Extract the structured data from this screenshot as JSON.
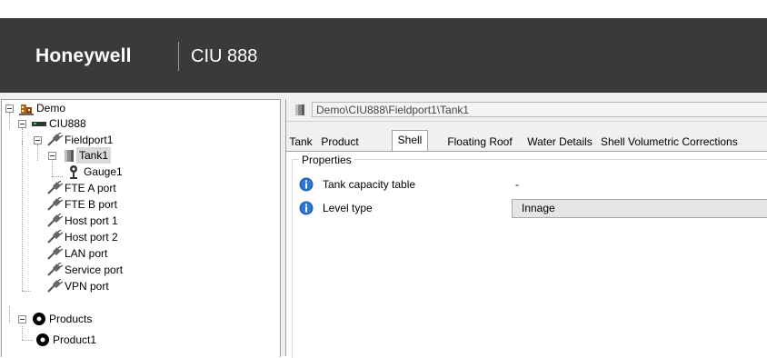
{
  "header": {
    "brand": "Honeywell",
    "product": "CIU 888",
    "background": "#3a3a3a"
  },
  "tree": {
    "nodes": [
      {
        "label": "Demo",
        "icon": "building-icon"
      },
      {
        "label": "CIU888",
        "icon": "device-icon"
      },
      {
        "label": "Fieldport1",
        "icon": "port-plug-icon"
      },
      {
        "label": "Tank1",
        "icon": "tank-icon",
        "selected": true
      },
      {
        "label": "Gauge1",
        "icon": "gauge-icon"
      },
      {
        "label": "FTE A port",
        "icon": "port-plug-icon"
      },
      {
        "label": "FTE B port",
        "icon": "port-plug-icon"
      },
      {
        "label": "Host port 1",
        "icon": "port-plug-icon"
      },
      {
        "label": "Host port 2",
        "icon": "port-plug-icon"
      },
      {
        "label": "LAN port",
        "icon": "port-plug-icon"
      },
      {
        "label": "Service port",
        "icon": "port-plug-icon"
      },
      {
        "label": "VPN port",
        "icon": "port-plug-icon"
      },
      {
        "label": "Products",
        "icon": "product-icon"
      },
      {
        "label": "Product1",
        "icon": "product-icon"
      }
    ]
  },
  "path": "Demo\\CIU888\\Fieldport1\\Tank1",
  "tabs": [
    {
      "label": "Tank",
      "active": false
    },
    {
      "label": "Product",
      "active": false
    },
    {
      "label": "Shell",
      "active": true
    },
    {
      "label": "Floating Roof",
      "active": false
    },
    {
      "label": "Water Details",
      "active": false
    },
    {
      "label": "Shell Volumetric Corrections",
      "active": false
    }
  ],
  "properties": {
    "group_title": "Properties",
    "rows": [
      {
        "label": "Tank capacity table",
        "value": "-",
        "icon": "info-icon"
      },
      {
        "label": "Level type",
        "value": "Innage",
        "icon": "info-icon"
      }
    ]
  }
}
